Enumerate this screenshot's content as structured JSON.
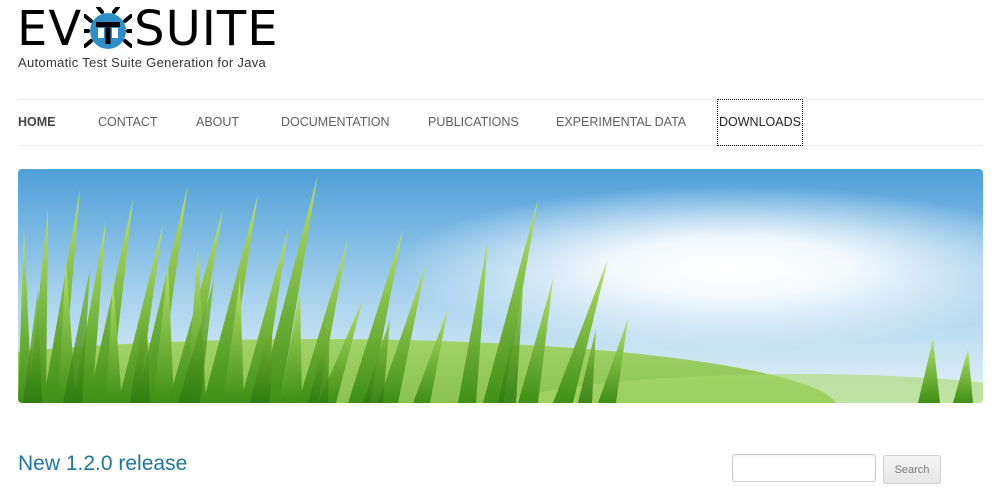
{
  "site": {
    "logo": {
      "left": "EV",
      "right": "SUITE",
      "icon": "bug-icon"
    },
    "tagline": "Automatic Test Suite Generation for Java"
  },
  "nav": {
    "items": [
      {
        "label": "HOME",
        "state": "active"
      },
      {
        "label": "CONTACT"
      },
      {
        "label": "ABOUT"
      },
      {
        "label": "DOCUMENTATION"
      },
      {
        "label": "PUBLICATIONS"
      },
      {
        "label": "EXPERIMENTAL DATA"
      },
      {
        "label": "DOWNLOADS",
        "state": "focused"
      }
    ]
  },
  "banner": {
    "description_icon": "grass-banner-image"
  },
  "main": {
    "post_title": "New 1.2.0 release"
  },
  "search": {
    "value": "",
    "placeholder": "",
    "button_label": "Search"
  },
  "colors": {
    "link": "#21759b",
    "nav_text": "#5e5e5e",
    "logo_blue": "#2e8fc7"
  }
}
